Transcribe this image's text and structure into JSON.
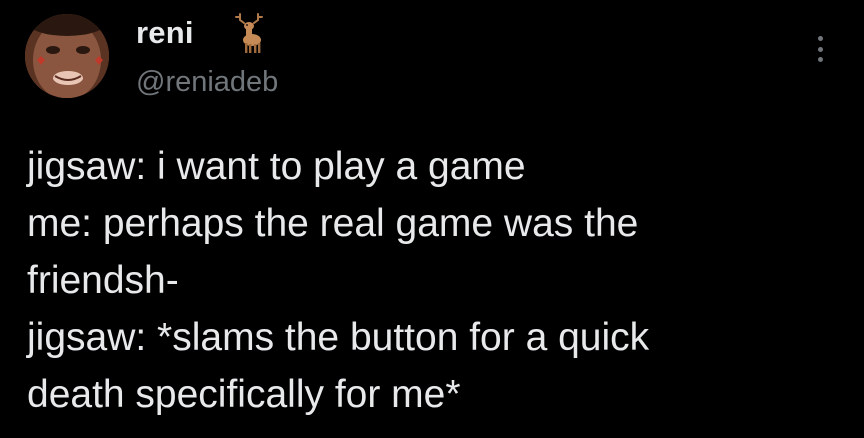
{
  "author": {
    "name": "reni",
    "handle": "@reniadeb",
    "name_emoji": "deer-emoji-icon"
  },
  "menu": {
    "icon": "more-options-icon"
  },
  "tweet": {
    "lines": [
      "jigsaw: i want to play a game",
      "me: perhaps the real game was the",
      "friendsh-",
      "jigsaw: *slams the button for a quick",
      "death specifically for me*"
    ]
  },
  "colors": {
    "background": "#000000",
    "text": "#e7e9ea",
    "secondary": "#71767b"
  }
}
